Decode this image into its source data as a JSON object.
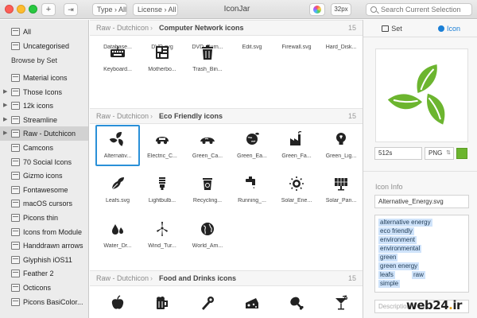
{
  "window": {
    "title": "IconJar",
    "filters": {
      "type": "Type › All",
      "license": "License › All"
    },
    "size_label": "32px",
    "search_placeholder": "Search Current Selection"
  },
  "sidebar": {
    "all": "All",
    "uncategorised": "Uncategorised",
    "browse_header": "Browse by Set",
    "sets": [
      "Material icons",
      "Those Icons",
      "12k icons",
      "Streamline",
      "Raw - Dutchicon",
      "Camcons",
      "70 Social Icons",
      "Gizmo icons",
      "Fontawesome",
      "macOS cursors",
      "Picons thin",
      "Icons from Module",
      "Handdrawn arrows",
      "Glyphish iOS11",
      "Feather 2",
      "Octicons",
      "Picons BasiColor..."
    ],
    "selected_set": "Raw - Dutchicon"
  },
  "main": {
    "top_captions": [
      "Database...",
      "DVD.svg",
      "DVD_Burn...",
      "Edit.svg",
      "Firewall.svg",
      "Hard_Disk..."
    ],
    "sections": [
      {
        "set": "Raw - Dutchicon",
        "name": "Computer Network icons",
        "count": "15",
        "icons": [
          {
            "caption": "Keyboard...",
            "icon": "keyboard-icon"
          },
          {
            "caption": "Motherbo...",
            "icon": "motherboard-icon"
          },
          {
            "caption": "Trash_Bin...",
            "icon": "trash-icon"
          }
        ]
      },
      {
        "set": "Raw - Dutchicon",
        "name": "Eco Friendly icons",
        "count": "15",
        "icons": [
          {
            "caption": "Alternativ...",
            "icon": "recycle-leaves-icon"
          },
          {
            "caption": "Electric_C...",
            "icon": "electric-car-icon"
          },
          {
            "caption": "Green_Ca...",
            "icon": "green-car-icon"
          },
          {
            "caption": "Green_Ea...",
            "icon": "green-earth-icon"
          },
          {
            "caption": "Green_Fa...",
            "icon": "factory-icon"
          },
          {
            "caption": "Green_Lig...",
            "icon": "lightbulb-icon"
          },
          {
            "caption": "Leafs.svg",
            "icon": "leaves-icon"
          },
          {
            "caption": "Lightbulb...",
            "icon": "cfl-bulb-icon"
          },
          {
            "caption": "Recycling...",
            "icon": "recycle-bin-icon"
          },
          {
            "caption": "Running_...",
            "icon": "running-water-icon"
          },
          {
            "caption": "Solar_Ene...",
            "icon": "sun-icon"
          },
          {
            "caption": "Solar_Pan...",
            "icon": "solar-panel-icon"
          },
          {
            "caption": "Water_Dr...",
            "icon": "water-drop-icon"
          },
          {
            "caption": "Wind_Tur...",
            "icon": "wind-turbine-icon"
          },
          {
            "caption": "World_Am...",
            "icon": "globe-icon"
          }
        ]
      },
      {
        "set": "Raw - Dutchicon",
        "name": "Food and Drinks icons",
        "count": "15",
        "icons": [
          {
            "caption": "",
            "icon": "apple-icon"
          },
          {
            "caption": "",
            "icon": "beer-mug-icon"
          },
          {
            "caption": "",
            "icon": "bottle-opener-icon"
          },
          {
            "caption": "",
            "icon": "cheese-icon"
          },
          {
            "caption": "",
            "icon": "drumstick-icon"
          },
          {
            "caption": "",
            "icon": "cocktail-icon"
          }
        ]
      }
    ]
  },
  "inspector": {
    "tabs": [
      "Set",
      "Icon"
    ],
    "active_tab": "Icon",
    "export_size": "512s",
    "export_format": "PNG",
    "export_color": "#6cb52f",
    "info_header": "Icon Info",
    "filename": "Alternative_Energy.svg",
    "tags": [
      "alternative energy",
      "eco friendly",
      "environment",
      "environmental",
      "green",
      "green energy",
      "leafs",
      "raw",
      "simple"
    ],
    "description_placeholder": "Description"
  },
  "watermark": "web24.ir"
}
